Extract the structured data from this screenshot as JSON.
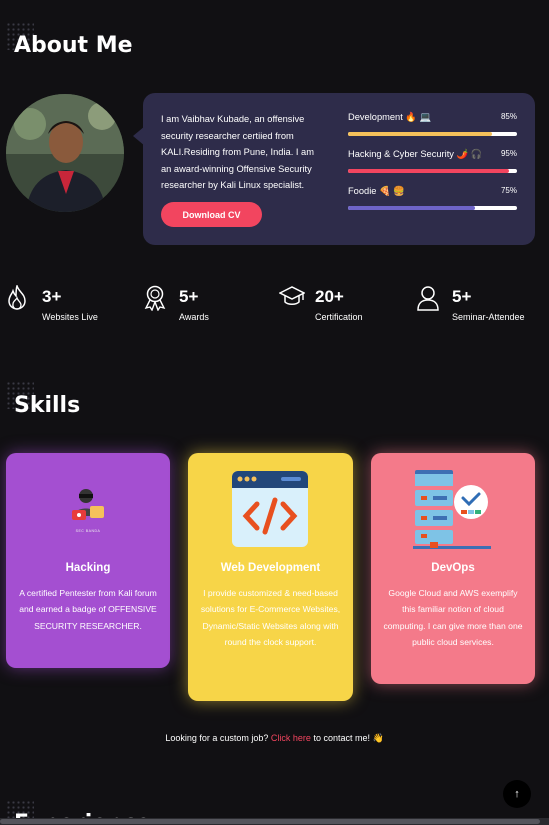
{
  "about": {
    "title": "About Me",
    "bio": "I am Vaibhav Kubade, an offensive security researcher certiied from KALI.Residing from Pune, India. I am an award-winning Offensive Security researcher by Kali Linux specialist.",
    "cv_button": "Download CV",
    "skills": [
      {
        "label": "Development 🔥 💻",
        "percent_text": "85%",
        "value": 0.85,
        "color": "#f5c15a"
      },
      {
        "label": "Hacking & Cyber Security 🌶️ 🎧",
        "percent_text": "95%",
        "value": 0.95,
        "color": "#f2455f"
      },
      {
        "label": "Foodie 🍕 🍔",
        "percent_text": "75%",
        "value": 0.75,
        "color": "#6e64c8"
      }
    ]
  },
  "stats": [
    {
      "icon": "fire-icon",
      "number": "3+",
      "caption": "Websites Live"
    },
    {
      "icon": "award-icon",
      "number": "5+",
      "caption": "Awards"
    },
    {
      "icon": "graduation-cap-icon",
      "number": "20+",
      "caption": "Certification"
    },
    {
      "icon": "user-icon",
      "number": "5+",
      "caption": "Seminar-Attendee"
    }
  ],
  "skills_section": {
    "title": "Skills",
    "cards": [
      {
        "title": "Hacking",
        "badge": "SEC BANDA",
        "desc": "A certified Pentester from Kali forum and earned a badge of OFFENSIVE SECURITY RESEARCHER.",
        "color": "#a44fd1"
      },
      {
        "title": "Web Development",
        "desc": "I provide customized & need-based solutions for E-Commerce Websites, Dynamic/Static Websites along with round the clock support.",
        "color": "#f7d548"
      },
      {
        "title": "DevOps",
        "desc": "Google Cloud and AWS exemplify this familiar notion of cloud computing. I can give more than one public cloud services.",
        "color": "#f47a8a"
      }
    ]
  },
  "contact": {
    "prefix": "Looking for a custom job?",
    "link": "Click here",
    "suffix": "to contact me! 👋"
  },
  "back_to_top": "↑",
  "next_section_title": "Experience"
}
